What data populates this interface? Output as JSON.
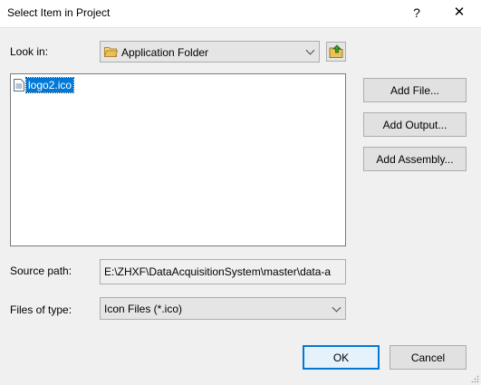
{
  "window": {
    "title": "Select Item in Project",
    "help": "?",
    "close": "✕"
  },
  "look_in": {
    "label": "Look in:",
    "value": "Application Folder"
  },
  "files": [
    {
      "name": "logo2.ico",
      "selected": true
    }
  ],
  "buttons": {
    "add_file": "Add File...",
    "add_output": "Add Output...",
    "add_assembly": "Add Assembly...",
    "ok": "OK",
    "cancel": "Cancel"
  },
  "source_path": {
    "label": "Source path:",
    "value": "E:\\ZHXF\\DataAcquisitionSystem\\master\\data-a"
  },
  "files_of_type": {
    "label": "Files of type:",
    "value": "Icon Files (*.ico)"
  },
  "colors": {
    "selection": "#0078d7",
    "default_button_border": "#0078d7",
    "folder_icon": "#e8c15c"
  }
}
